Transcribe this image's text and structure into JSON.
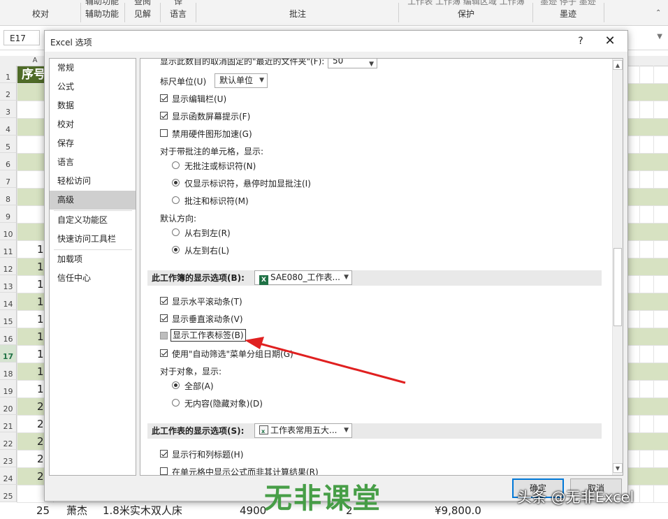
{
  "ribbon": {
    "groups": [
      {
        "top": "",
        "bottom": "校对"
      },
      {
        "top": "辅助功能",
        "bottom": "辅助功能"
      },
      {
        "top": "查阅",
        "bottom": "见解"
      },
      {
        "top": "译",
        "bottom": "语言"
      },
      {
        "top": "",
        "bottom": "批注"
      },
      {
        "top": "工作表 工作簿 编辑区域 工作簿",
        "bottom": "保护"
      },
      {
        "top": "墨迹 停子 墨迹",
        "bottom": "墨迹"
      }
    ]
  },
  "formula_bar": {
    "name_box": "E17"
  },
  "sheet": {
    "col_a_label": "A",
    "header_cell": "序号",
    "row_numbers": [
      "1",
      "2",
      "3",
      "4",
      "5",
      "6",
      "7",
      "8",
      "9",
      "10",
      "11",
      "12",
      "13",
      "14",
      "15",
      "16",
      "17",
      "18",
      "19",
      "20",
      "21",
      "22",
      "23",
      "24",
      "25"
    ],
    "row_a_values": [
      "",
      "",
      "",
      "",
      "",
      "",
      "",
      "",
      "",
      "",
      "1",
      "1",
      "1",
      "1",
      "1",
      "1",
      "1",
      "1",
      "1",
      "2",
      "2",
      "2",
      "2",
      "2",
      ""
    ],
    "bottom_row": {
      "num": "25",
      "name": "萧杰",
      "product": "1.8米实木双人床",
      "qty_a": "4900",
      "qty_b": "2",
      "amount": "¥9,800.0"
    }
  },
  "dialog": {
    "title": "Excel 选项",
    "help": "?",
    "close": "✕",
    "nav": [
      "常规",
      "公式",
      "数据",
      "校对",
      "保存",
      "语言",
      "轻松访问",
      "高级",
      "自定义功能区",
      "快速访问工具栏",
      "加载项",
      "信任中心"
    ],
    "nav_active": "高级",
    "content": {
      "recent_folders_label": "显示此数目的取消固定的\"最近的文件夹\"(F):",
      "recent_folders_value": "50",
      "ruler_label": "标尺单位(U)",
      "ruler_value": "默认单位",
      "cb_formula_bar": "显示编辑栏(U)",
      "cb_function_tips": "显示函数屏幕提示(F)",
      "cb_hw_accel": "禁用硬件图形加速(G)",
      "comments_label": "对于带批注的单元格，显示:",
      "rb_no_comments": "无批注或标识符(N)",
      "rb_indicator_only": "仅显示标识符，悬停时加显批注(I)",
      "rb_comments_and_indicator": "批注和标识符(M)",
      "direction_label": "默认方向:",
      "rb_rtl": "从右到左(R)",
      "rb_ltr": "从左到右(L)",
      "workbook_section": "此工作簿的显示选项(B):",
      "workbook_select": "SAE080_工作表...",
      "cb_hscroll": "显示水平滚动条(T)",
      "cb_vscroll": "显示垂直滚动条(V)",
      "cb_sheet_tabs": "显示工作表标签(B)",
      "cb_autofilter": "使用\"自动筛选\"菜单分组日期(G)",
      "objects_label": "对于对象，显示:",
      "rb_all": "全部(A)",
      "rb_nothing": "无内容(隐藏对象)(D)",
      "worksheet_section": "此工作表的显示选项(S):",
      "worksheet_select": "工作表常用五大...",
      "cb_row_col_headers": "显示行和列标题(H)",
      "cb_formulas": "在单元格中显示公式而非其计算结果(R)"
    },
    "ok": "确定",
    "cancel": "取消"
  },
  "watermark": {
    "main": "无非课堂",
    "sub": "头条 @无非Excel"
  },
  "colors": {
    "excel_green": "#217346",
    "arrow_red": "#e02020",
    "header_green": "#4f6b28",
    "band_green": "#d7e2c2"
  }
}
